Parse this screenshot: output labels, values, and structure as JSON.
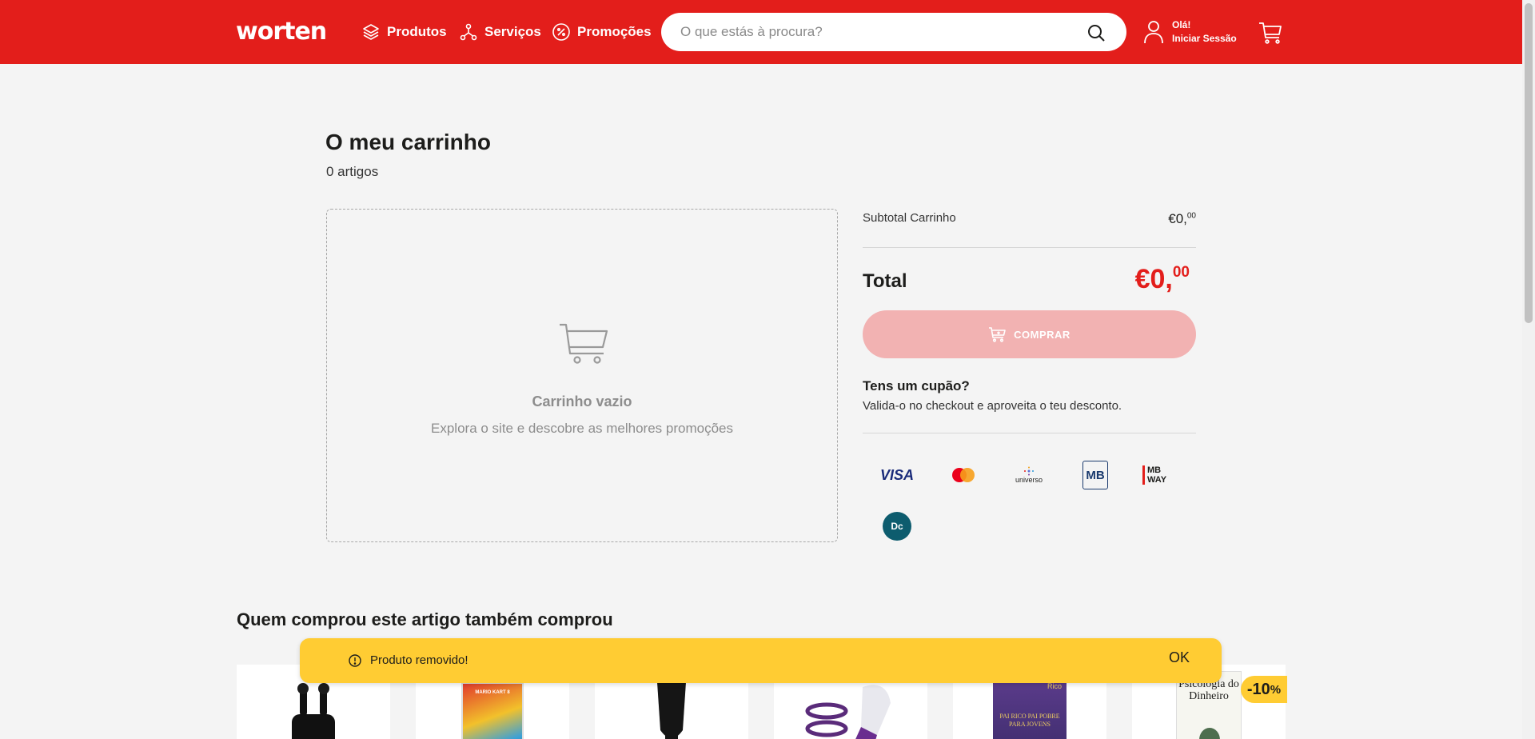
{
  "header": {
    "logo": "worten",
    "nav": [
      {
        "label": "Produtos",
        "icon": "layers-icon"
      },
      {
        "label": "Serviços",
        "icon": "services-icon"
      },
      {
        "label": "Promoções",
        "icon": "percent-icon"
      }
    ],
    "search_placeholder": "O que estás à procura?",
    "user_greeting": "Olá!",
    "user_login": "Iniciar Sessão"
  },
  "cart": {
    "title": "O meu carrinho",
    "count": "0 artigos",
    "empty_title": "Carrinho vazio",
    "empty_subtitle": "Explora o site e descobre as melhores promoções"
  },
  "summary": {
    "subtotal_label": "Subtotal Carrinho",
    "subtotal_main": "€0,",
    "subtotal_cents": "00",
    "total_label": "Total",
    "total_main": "€0,",
    "total_cents": "00",
    "buy_label": "COMPRAR",
    "coupon_title": "Tens um cupão?",
    "coupon_text": "Valida-o no checkout e aproveita o teu desconto.",
    "payment_methods": [
      {
        "name": "VISA",
        "icon": "visa-icon"
      },
      {
        "name": "Mastercard",
        "icon": "mastercard-icon"
      },
      {
        "name": "universo",
        "icon": "universo-icon"
      },
      {
        "name": "MB",
        "icon": "multibanco-icon"
      },
      {
        "name": "MB WAY",
        "icon": "mbway-icon"
      },
      {
        "name": "Dc",
        "icon": "cofidis-icon"
      }
    ]
  },
  "recommendations": {
    "title": "Quem comprou este artigo também comprou",
    "products": [
      {
        "icon": "earbuds-icon"
      },
      {
        "icon": "mario-kart-game-icon",
        "text": "MARIO KART 8"
      },
      {
        "icon": "hair-dryer-icon"
      },
      {
        "icon": "massager-icon"
      },
      {
        "icon": "book-icon",
        "text": "PAI RICO PAI POBRE PARA JOVENS",
        "corner": "Rico"
      },
      {
        "icon": "book-icon",
        "text": "Psicologia do Dinheiro",
        "discount": "-10",
        "pct": "%"
      }
    ]
  },
  "toast": {
    "message": "Produto removido!",
    "ok": "OK"
  },
  "colors": {
    "brand": "#e31e1b",
    "toast": "#ffcc33",
    "buy_disabled": "#f2b2b2"
  }
}
